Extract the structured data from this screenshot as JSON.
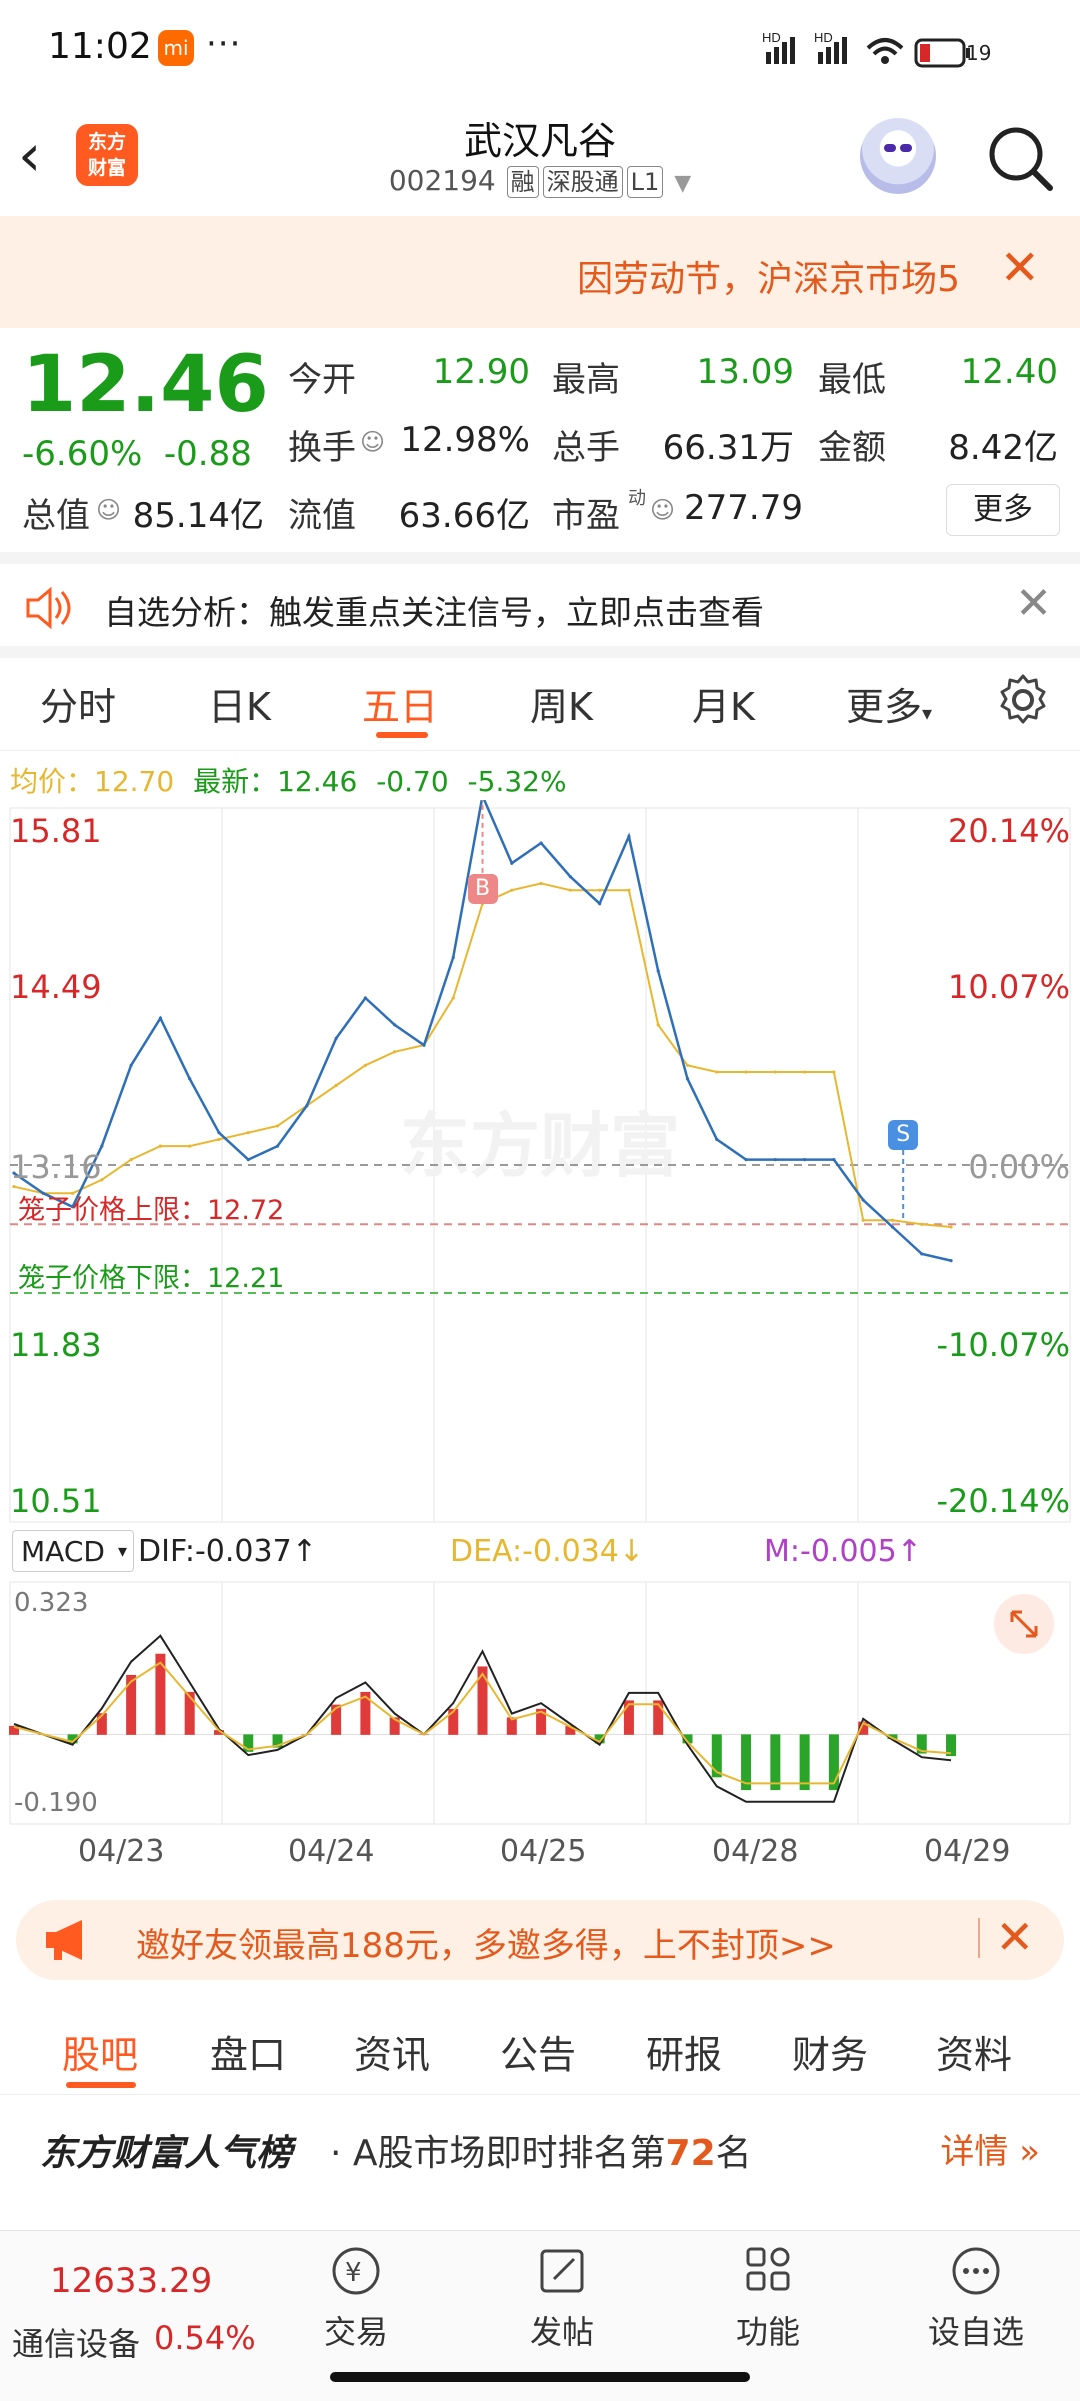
{
  "status_bar": {
    "time": "11:02",
    "app_badge": "mi",
    "more": "···",
    "battery": "19",
    "signal1": "HD",
    "signal2": "HD"
  },
  "header": {
    "logo_text": "东方财富",
    "title": "武汉凡谷",
    "code": "002194",
    "tags": [
      "融",
      "深股通",
      "L1"
    ]
  },
  "banner": {
    "text": "因劳动节，沪深京市场5",
    "close": "✕"
  },
  "quote": {
    "price": "12.46",
    "change_pct": "-6.60%",
    "change_amt": "-0.88",
    "open_label": "今开",
    "open": "12.90",
    "high_label": "最高",
    "high": "13.09",
    "low_label": "最低",
    "low": "12.40",
    "turnover_label": "换手",
    "turnover": "12.98%",
    "volume_label": "总手",
    "volume": "66.31万",
    "amount_label": "金额",
    "amount": "8.42亿",
    "mktcap_label": "总值",
    "mktcap": "85.14亿",
    "float_label": "流值",
    "float_cap": "63.66亿",
    "pe_label": "市盈",
    "pe_sup": "动",
    "pe": "277.79",
    "more": "更多"
  },
  "notice": {
    "text": "自选分析：触发重点关注信号，立即点击查看",
    "close": "✕"
  },
  "chart_tabs": {
    "items": [
      "分时",
      "日K",
      "五日",
      "周K",
      "月K",
      "更多"
    ],
    "active": "五日"
  },
  "legend": {
    "avg_label": "均价：",
    "avg": "12.70",
    "latest_label": "最新：",
    "latest": "12.46",
    "chg": "-0.70",
    "pct": "-5.32%"
  },
  "chart_data": {
    "type": "line",
    "title": "",
    "x": [
      "04/23",
      "04/24",
      "04/25",
      "04/28",
      "04/29"
    ],
    "ylabels_left": [
      "15.81",
      "14.49",
      "13.16",
      "11.83",
      "10.51"
    ],
    "ylabels_right": [
      "20.14%",
      "10.07%",
      "0.00%",
      "-10.07%",
      "-20.14%"
    ],
    "ylim": [
      10.51,
      15.81
    ],
    "prev_close": 13.16,
    "cage_upper_label": "笼子价格上限：",
    "cage_upper": "12.72",
    "cage_lower_label": "笼子价格下限：",
    "cage_lower": "12.21",
    "buy_marker": "B",
    "sell_marker": "S",
    "series": [
      {
        "name": "最新",
        "color": "#2f6fb8",
        "values": [
          13.1,
          12.95,
          12.85,
          13.3,
          13.9,
          14.25,
          13.8,
          13.4,
          13.2,
          13.3,
          13.6,
          14.1,
          14.4,
          14.2,
          14.05,
          14.7,
          15.9,
          15.4,
          15.55,
          15.3,
          15.1,
          15.6,
          14.6,
          13.8,
          13.35,
          13.2,
          13.2,
          13.2,
          13.2,
          12.9,
          12.7,
          12.5,
          12.45
        ]
      },
      {
        "name": "均价",
        "color": "#e8b730",
        "values": [
          13.0,
          12.95,
          12.95,
          13.05,
          13.2,
          13.3,
          13.3,
          13.35,
          13.4,
          13.45,
          13.6,
          13.75,
          13.9,
          14.0,
          14.05,
          14.4,
          15.1,
          15.2,
          15.25,
          15.2,
          15.2,
          15.2,
          14.2,
          13.9,
          13.85,
          13.85,
          13.85,
          13.85,
          13.85,
          12.75,
          12.75,
          12.72,
          12.7
        ]
      }
    ]
  },
  "macd": {
    "selector": "MACD",
    "dif_label": "DIF:",
    "dif": "-0.037",
    "dif_arrow": "↑",
    "dea_label": "DEA:",
    "dea": "-0.034",
    "dea_arrow": "↓",
    "m_label": "M:",
    "m": "-0.005",
    "m_arrow": "↑",
    "top": "0.323",
    "bottom": "-0.190"
  },
  "promo": {
    "text": "邀好友领最高188元，多邀多得，上不封顶>>",
    "close": "✕"
  },
  "info_tabs": {
    "items": [
      "股吧",
      "盘口",
      "资讯",
      "公告",
      "研报",
      "财务",
      "资料"
    ],
    "active": "股吧"
  },
  "rank": {
    "brand": "东方财富人气榜",
    "text_prefix": "· A股市场即时排名第",
    "rank": "72",
    "text_suffix": "名",
    "detail": "详情"
  },
  "bottom_nav": {
    "index_value": "12633.29",
    "index_name": "通信设备",
    "index_pct": "0.54%",
    "items": [
      {
        "label": "交易",
        "icon": "trade-icon"
      },
      {
        "label": "发帖",
        "icon": "post-icon"
      },
      {
        "label": "功能",
        "icon": "apps-icon"
      },
      {
        "label": "设自选",
        "icon": "more-circle-icon"
      }
    ]
  },
  "colors": {
    "accent": "#ff5a1f",
    "up": "#d62828",
    "down": "#1a9b1a",
    "line": "#2f6fb8",
    "avg": "#e8b730"
  }
}
